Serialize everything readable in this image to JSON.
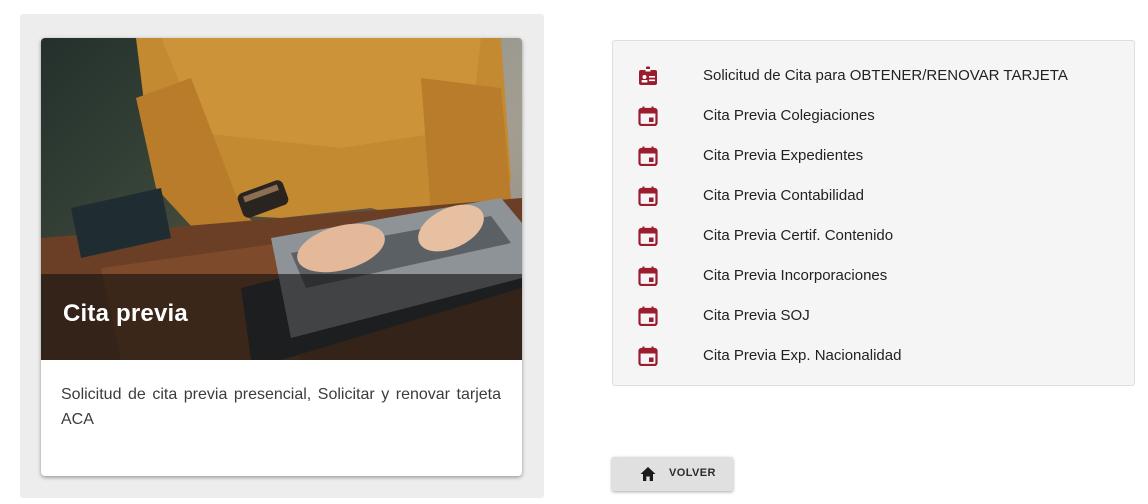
{
  "card": {
    "title": "Cita previa",
    "description": "Solicitud de cita previa presencial, Solicitar y renovar tarjeta ACA",
    "image": "laptop-typing-photo"
  },
  "menu": {
    "items": [
      {
        "label": "Solicitud de Cita para OBTENER/RENOVAR TARJETA",
        "icon": "id-badge-icon"
      },
      {
        "label": "Cita Previa Colegiaciones",
        "icon": "calendar-icon"
      },
      {
        "label": "Cita Previa Expedientes",
        "icon": "calendar-icon"
      },
      {
        "label": "Cita Previa Contabilidad",
        "icon": "calendar-icon"
      },
      {
        "label": "Cita Previa Certif. Contenido",
        "icon": "calendar-icon"
      },
      {
        "label": "Cita Previa Incorporaciones",
        "icon": "calendar-icon"
      },
      {
        "label": "Cita Previa SOJ",
        "icon": "calendar-icon"
      },
      {
        "label": "Cita Previa Exp. Nacionalidad",
        "icon": "calendar-icon"
      }
    ]
  },
  "back_button": {
    "label": "VOLVER",
    "icon": "home-icon"
  },
  "colors": {
    "accent": "#9b1c2c",
    "panel": "#ededed",
    "menu_bg": "#f5f5f5",
    "button_bg": "#e0e0e0"
  }
}
